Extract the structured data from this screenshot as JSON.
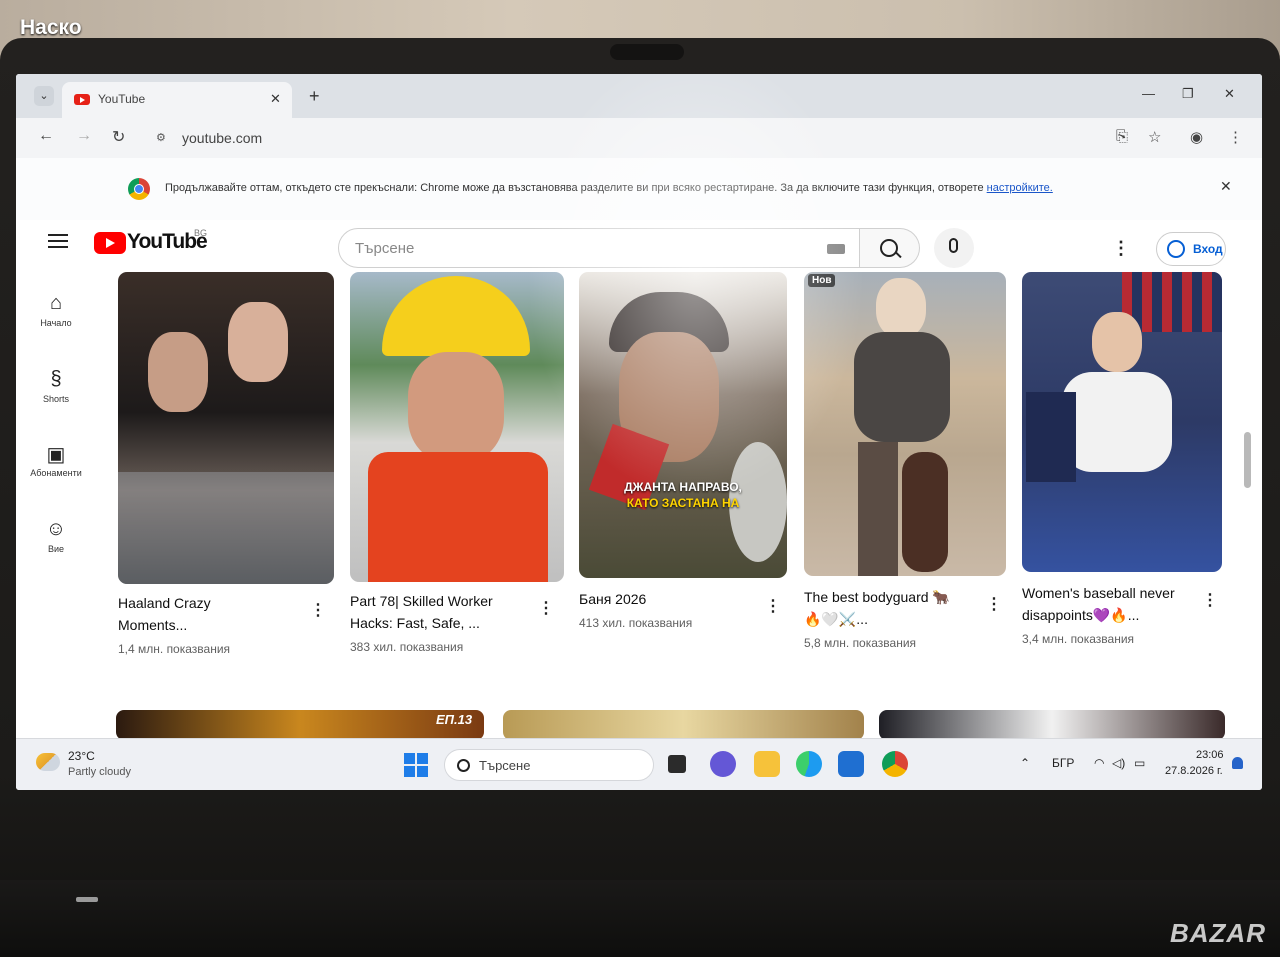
{
  "watermark": {
    "user": "Наско",
    "site": "BAZAR"
  },
  "browser": {
    "tab_title": "YouTube",
    "url": "youtube.com",
    "infobar": {
      "text": "Продължавайте оттам, откъдето сте прекъснали: Chrome може да възстановява разделите ви при всяко рестартиране. За да включите тази функция, отворете",
      "link": "настройките."
    }
  },
  "youtube": {
    "logo_text": "YouTube",
    "country": "BG",
    "search_placeholder": "Търсене",
    "sign_in": "Вход",
    "sidebar": [
      {
        "label": "Начало",
        "icon": "home-icon"
      },
      {
        "label": "Shorts",
        "icon": "shorts-icon"
      },
      {
        "label": "Абонаменти",
        "icon": "subscriptions-icon"
      },
      {
        "label": "Вие",
        "icon": "you-icon"
      }
    ],
    "videos": [
      {
        "title_line1": "Haaland Crazy",
        "title_line2": "Moments...",
        "views": "1,4 млн. показвания"
      },
      {
        "title_line1": "Part 78| Skilled Worker",
        "title_line2": "Hacks: Fast, Safe, ...",
        "views": "383 хил. показвания"
      },
      {
        "title_line1": "Баня 2026",
        "title_line2": "",
        "views": "413 хил. показвания",
        "overlay_line1": "ДЖАНТА НАПРАВО,",
        "overlay_line2": "КАТО ЗАСТАНА НА"
      },
      {
        "title_line1": "The best bodyguard 🐂",
        "title_line2": "🔥🤍⚔️...",
        "views": "5,8 млн. показвания",
        "badge": "Нов"
      },
      {
        "title_line1": "Women's baseball never",
        "title_line2": "disappoints💜🔥...",
        "views": "3,4 млн. показвания"
      }
    ],
    "row2_overlay": "ЕП.13"
  },
  "taskbar": {
    "temperature": "23°C",
    "weather": "Partly cloudy",
    "search_label": "Търсене",
    "language": "БГР",
    "time": "23:06",
    "date": "27.8.2026 г."
  }
}
